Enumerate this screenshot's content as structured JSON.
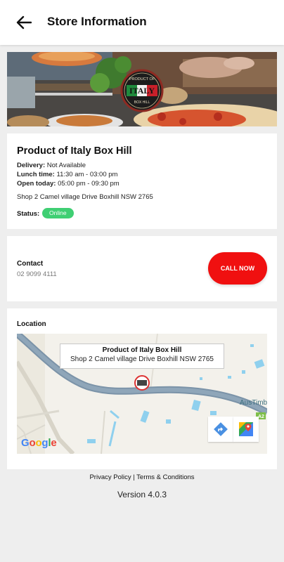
{
  "header": {
    "title": "Store Information",
    "back_icon": "arrow-left-icon"
  },
  "hero": {
    "logo_top": "PRODUCT OF",
    "logo_main": "ITALY",
    "logo_bottom": "BOX HILL"
  },
  "store": {
    "name": "Product of Italy Box Hill",
    "delivery_label": "Delivery:",
    "delivery_value": "Not Available",
    "lunch_label": "Lunch time:",
    "lunch_value": "11:30 am - 03:00 pm",
    "open_label": "Open today:",
    "open_value": "05:00 pm - 09:30 pm",
    "address": "Shop 2 Camel village Drive Boxhill NSW 2765",
    "status_label": "Status:",
    "status_value": "Online",
    "status_color": "#3fcf73"
  },
  "contact": {
    "label": "Contact",
    "phone": "02 9099 4111",
    "call_button": "CALL NOW",
    "call_color": "#f01010"
  },
  "location": {
    "label": "Location",
    "callout_title": "Product of Italy Box Hill",
    "callout_address": "Shop 2 Camel village Drive Boxhill NSW 2765",
    "map_place_label": "AusTimb",
    "road_shield": "A2",
    "attribution": "Google",
    "directions_icon": "directions-icon",
    "maps_icon": "google-maps-icon"
  },
  "footer": {
    "privacy": "Privacy Policy",
    "separator": " | ",
    "terms": "Terms & Conditions",
    "version": "Version 4.0.3"
  }
}
